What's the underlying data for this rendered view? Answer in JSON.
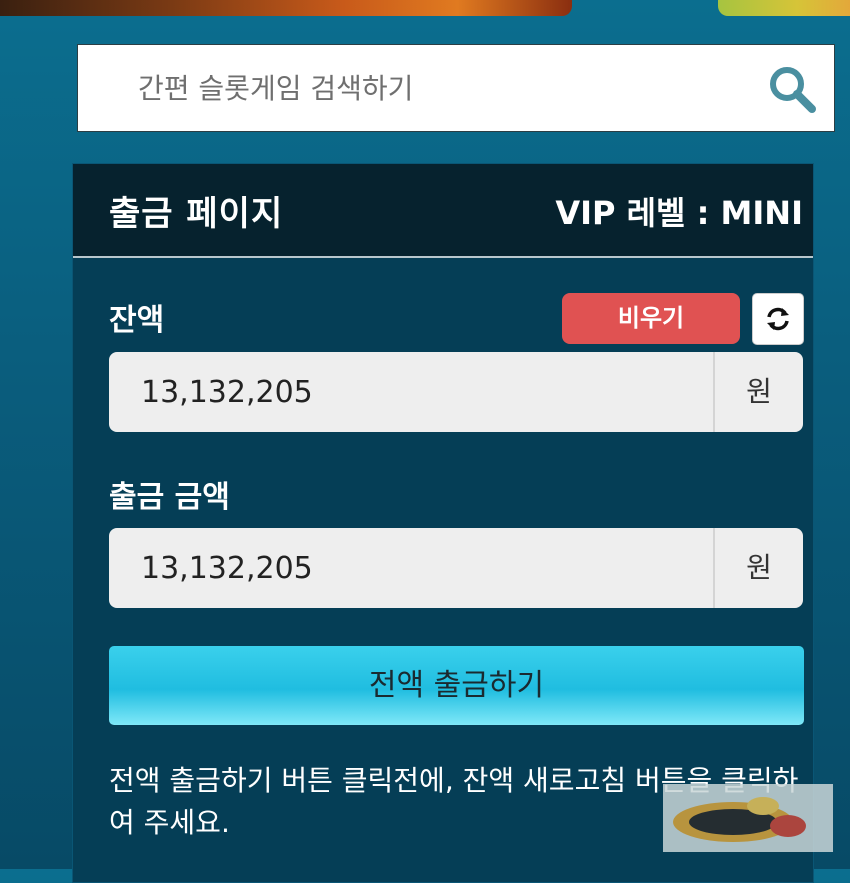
{
  "search": {
    "placeholder": "간편 슬롯게임 검색하기"
  },
  "panel": {
    "title": "출금 페이지",
    "vip_label": "VIP 레벨 : MINI"
  },
  "balance": {
    "label": "잔액",
    "clear_label": "비우기",
    "value": "13,132,205",
    "unit": "원"
  },
  "withdraw": {
    "label": "출금 금액",
    "value": "13,132,205",
    "unit": "원",
    "button_label": "전액 출금하기"
  },
  "notice": "전액 출금하기 버튼 클릭전에, 잔액 새로고침 버튼을 클릭하여 주세요.",
  "colors": {
    "background": "#0a5e7e",
    "panel": "#053e56",
    "header": "#06222e",
    "clear_button": "#e05252",
    "withdraw_button": "#20bde0"
  },
  "icons": {
    "search": "search-icon",
    "refresh": "refresh-icon"
  }
}
